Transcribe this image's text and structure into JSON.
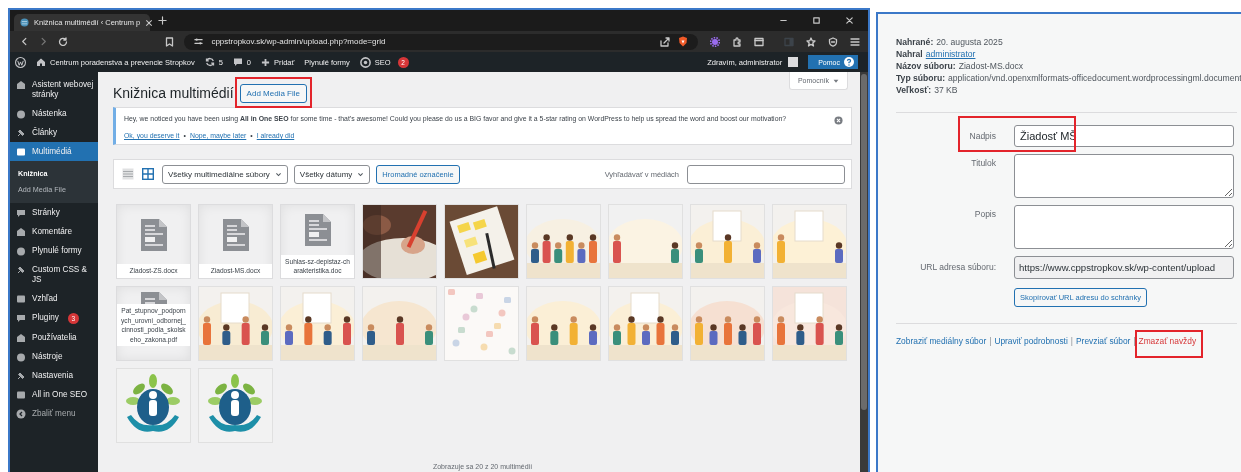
{
  "browser": {
    "tab_title": "Knižnica multimédií ‹ Centrum p",
    "address": "cppstropkov.sk/wp-admin/upload.php?mode=grid"
  },
  "admin_bar": {
    "site": "Centrum poradenstva a prevencie Stropkov",
    "updates": "5",
    "comments": "0",
    "new": "Pridať",
    "forms": "Plynulé formy",
    "seo": "SEO",
    "seo_badge": "2",
    "greeting": "Zdravím, administrator",
    "help": "Pomoc"
  },
  "sidebar": {
    "items": [
      {
        "label": "Asistent webovej stránky",
        "selected": false
      },
      {
        "label": "Nástenka",
        "selected": false
      },
      {
        "label": "Články",
        "selected": false
      },
      {
        "label": "Multimédiá",
        "selected": true,
        "children": [
          {
            "label": "Knižnica",
            "selected": true
          },
          {
            "label": "Add Media File",
            "selected": false
          }
        ]
      },
      {
        "label": "Stránky",
        "selected": false
      },
      {
        "label": "Komentáre",
        "selected": false
      },
      {
        "label": "Plynulé formy",
        "selected": false
      },
      {
        "label": "Custom CSS & JS",
        "selected": false
      },
      {
        "label": "Vzhľad",
        "selected": false
      },
      {
        "label": "Pluginy",
        "selected": false,
        "badge": "3"
      },
      {
        "label": "Používatelia",
        "selected": false
      },
      {
        "label": "Nástroje",
        "selected": false
      },
      {
        "label": "Nastavenia",
        "selected": false
      },
      {
        "label": "All in One SEO",
        "selected": false
      }
    ],
    "collapse": "Zbaliť menu"
  },
  "page": {
    "title": "Knižnica multimédií",
    "add_button": {
      "label": "Add Media File",
      "highlighted": true
    },
    "help_tab": "Pomocník"
  },
  "notice": {
    "text": "Hey, we noticed you have been using **All in One SEO** for some time - that's awesome! Could you please do us a BIG favor and give it a 5-star rating on WordPress to help us spread the word and boost our motivation?",
    "links": [
      "Ok, you deserve it",
      "Nope, maybe later",
      "I already did"
    ],
    "separator": "•"
  },
  "toolbar": {
    "views": [
      {
        "kind": "list",
        "selected": false
      },
      {
        "kind": "grid",
        "selected": true
      }
    ],
    "type_filter": "Všetky multimediálne súbory",
    "date_filter": "Všetky dátumy",
    "bulk_button": "Hromadné označenie",
    "search_label": "Vyhľadávať v médiách"
  },
  "media": [
    {
      "kind": "document",
      "filename": "Ziadost-ZS.docx"
    },
    {
      "kind": "document",
      "filename": "Ziadost-MS.docx"
    },
    {
      "kind": "document",
      "filename": "Suhlas-sz-depistaz-charakteristika.doc"
    },
    {
      "kind": "picture"
    },
    {
      "kind": "picture"
    },
    {
      "kind": "picture"
    },
    {
      "kind": "picture"
    },
    {
      "kind": "picture"
    },
    {
      "kind": "picture"
    },
    {
      "kind": "document",
      "filename": "Pat_stupnov_podpornych_urovni_odbornej_cinnosti_podla_skolskeho_zakona.pdf"
    },
    {
      "kind": "picture"
    },
    {
      "kind": "picture"
    },
    {
      "kind": "picture"
    },
    {
      "kind": "picture"
    },
    {
      "kind": "picture"
    },
    {
      "kind": "picture"
    },
    {
      "kind": "picture"
    },
    {
      "kind": "picture"
    },
    {
      "kind": "picture"
    },
    {
      "kind": "picture"
    }
  ],
  "footer": "Zobrazuje sa 20 z 20 multimédií",
  "details": {
    "meta": [
      {
        "label": "Nahrané:",
        "value": "20. augusta 2025"
      },
      {
        "label": "Nahral",
        "link": "administrator"
      },
      {
        "label": "Názov súboru:",
        "value": "Ziadost-MS.docx"
      },
      {
        "label": "Typ súboru:",
        "value": "application/vnd.openxmlformats-officedocument.wordprocessingml.document"
      },
      {
        "label": "Veľkosť:",
        "value": "37 KB"
      }
    ],
    "fields": [
      {
        "kind": "text",
        "label": "Nadpis",
        "value": "Žiadosť MŠ",
        "highlighted": true
      },
      {
        "kind": "textarea",
        "label": "Titulok",
        "highlighted": false
      },
      {
        "kind": "textarea",
        "label": "Popis",
        "highlighted": false
      },
      {
        "kind": "readonly",
        "label": "URL adresa súboru:",
        "value": "https://www.cppstropkov.sk/wp-content/upload",
        "highlighted": false
      }
    ],
    "copy_button": "Skopírovať URL adresu do schránky",
    "actions": [
      {
        "kind": "link",
        "label": "Zobraziť mediálny súbor",
        "highlighted": false
      },
      {
        "kind": "link",
        "label": "Upraviť podrobnosti",
        "highlighted": false
      },
      {
        "kind": "link",
        "label": "Prevziať súbor",
        "highlighted": false
      },
      {
        "kind": "delete",
        "label": "Zmazať navždy",
        "highlighted": true
      }
    ],
    "action_separator": "|"
  }
}
